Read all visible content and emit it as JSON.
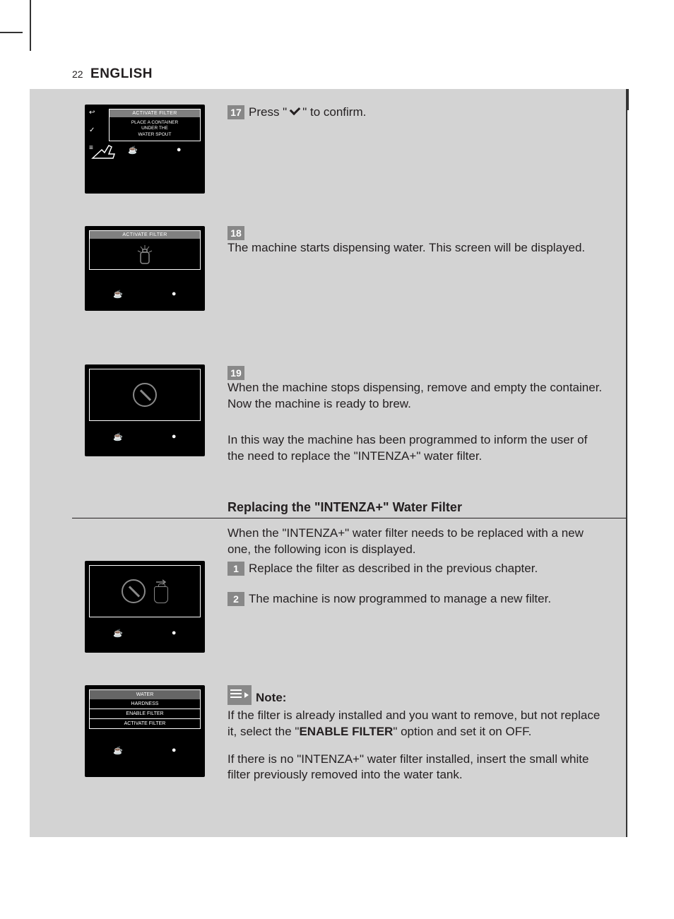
{
  "header": {
    "page_number": "22",
    "language": "ENGLISH"
  },
  "screen1": {
    "title": "ACTIVATE FILTER",
    "body_l1": "PLACE A CONTAINER",
    "body_l2": "UNDER THE",
    "body_l3": "WATER SPOUT"
  },
  "step17": {
    "num": "17",
    "pre": " Press \"",
    "post": "\" to confirm."
  },
  "screen2": {
    "title": "ACTIVATE FILTER"
  },
  "step18": {
    "num": "18",
    "text": " The machine starts dispensing water. This screen will be displayed."
  },
  "step19": {
    "num": "19",
    "text": " When the machine stops dispensing, remove and empty the container. Now the machine is ready to brew."
  },
  "info19": "In this way the machine has been programmed to inform the user of the need to replace the \"INTENZA+\" water filter.",
  "section": {
    "title": "Replacing the \"INTENZA+\" Water Filter"
  },
  "replace_intro": "When the \"INTENZA+\" water filter needs to be replaced with a new one, the following icon is displayed.",
  "step1": {
    "num": "1",
    "text": " Replace the filter as described in the previous chapter."
  },
  "step2": {
    "num": "2",
    "text": " The machine is now programmed to manage a new filter."
  },
  "menu": {
    "header": "WATER",
    "r1": "HARDNESS",
    "r2": "ENABLE FILTER",
    "r3": "ACTIVATE FILTER"
  },
  "note": {
    "label": "Note:",
    "p1_a": "If the filter is already installed and you want to remove, but not replace it, select the \"",
    "p1_bold": "ENABLE FILTER",
    "p1_b": "\" option and set it on OFF.",
    "p2": "If there is no \"INTENZA+\" water filter installed, insert the small white filter previously removed into the water tank."
  },
  "icons": {
    "cup": "☕",
    "bean": "●",
    "back": "↩",
    "list": "≡",
    "check": "✓"
  }
}
